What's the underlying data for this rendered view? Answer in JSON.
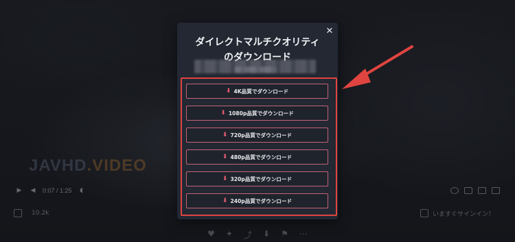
{
  "video": {
    "watermark_main": "JAVHD",
    "watermark_accent": ".VIDEO",
    "time": "0:07 / 1:25",
    "views": "10.2k",
    "signin_text": "いますぐサインイン！"
  },
  "modal": {
    "title": "ダイレクトマルチクオリティのダウンロード",
    "close_label": "✕",
    "buttons": [
      {
        "label": "4K品質でダウンロード"
      },
      {
        "label": "1080p品質でダウンロード"
      },
      {
        "label": "720p品質でダウンロード"
      },
      {
        "label": "480p品質でダウンロード"
      },
      {
        "label": "320p品質でダウンロード"
      },
      {
        "label": "240p品質でダウンロード"
      }
    ]
  },
  "icons": {
    "download": "download-icon",
    "close": "close-icon",
    "play": "play-icon",
    "volume": "volume-icon",
    "settings": "gear-icon",
    "fullscreen": "fullscreen-icon"
  },
  "colors": {
    "modal_bg": "#232833",
    "button_border": "#c76477",
    "download_icon": "#e05a6d",
    "highlight": "#e04440"
  }
}
